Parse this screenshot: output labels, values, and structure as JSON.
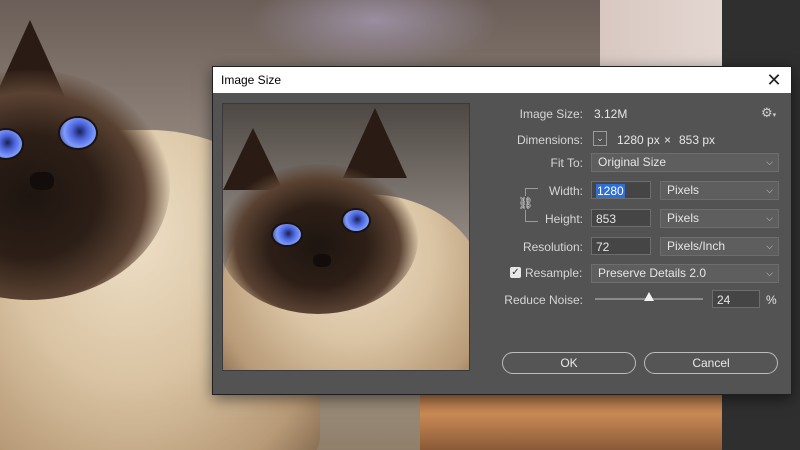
{
  "dialog": {
    "title": "Image Size",
    "close_glyph": "✕",
    "image_size_label": "Image Size:",
    "image_size_value": "3.12M",
    "dimensions_label": "Dimensions:",
    "dimensions_width": "1280 px",
    "dimensions_times": "×",
    "dimensions_height": "853 px",
    "fit_to_label": "Fit To:",
    "fit_to_value": "Original Size",
    "width_label": "Width:",
    "width_value": "1280",
    "width_unit": "Pixels",
    "height_label": "Height:",
    "height_value": "853",
    "height_unit": "Pixels",
    "resolution_label": "Resolution:",
    "resolution_value": "72",
    "resolution_unit": "Pixels/Inch",
    "resample_label": "Resample:",
    "resample_checked": true,
    "resample_value": "Preserve Details 2.0",
    "reduce_noise_label": "Reduce Noise:",
    "reduce_noise_value": "24",
    "reduce_noise_unit": "%",
    "ok_label": "OK",
    "cancel_label": "Cancel"
  },
  "icons": {
    "settings": "gear-icon",
    "close": "close-icon",
    "chain": "chain-link-icon",
    "chevron": "chevron-down-icon"
  },
  "colors": {
    "dialog_bg": "#535353",
    "selection": "#2e6fd6"
  }
}
